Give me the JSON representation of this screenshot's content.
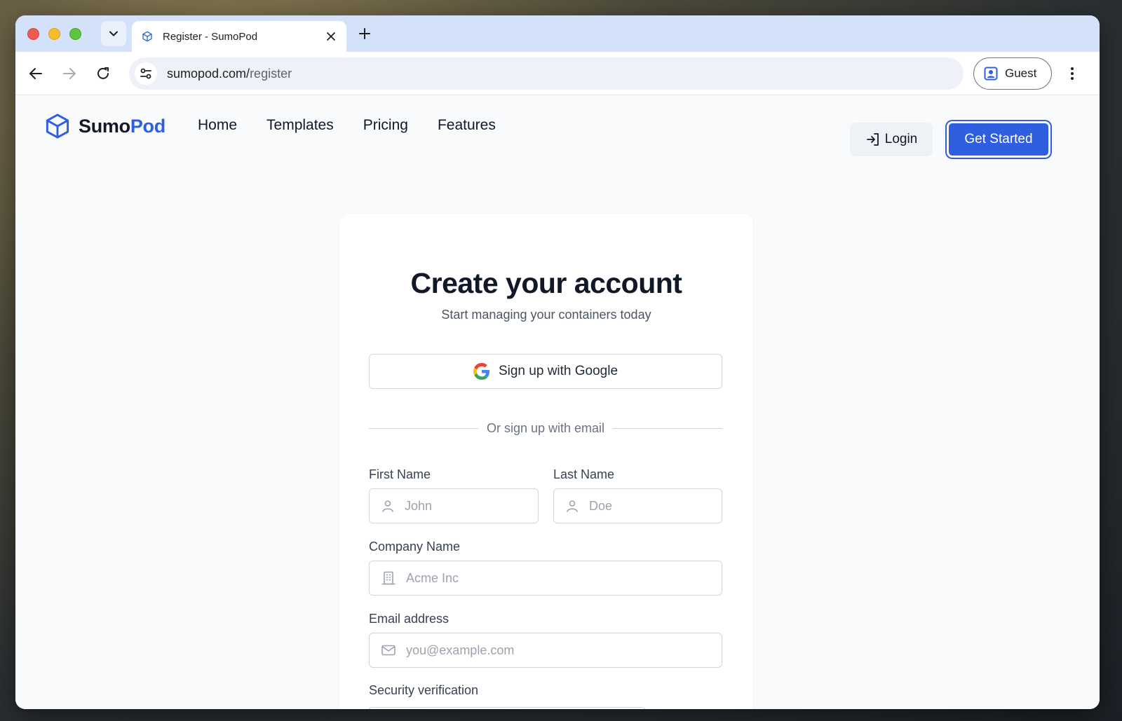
{
  "browser": {
    "tab_title": "Register - SumoPod",
    "url_host": "sumopod.com/",
    "url_path": "register",
    "profile_label": "Guest"
  },
  "site": {
    "brand_part1": "Sumo",
    "brand_part2": "Pod",
    "nav": [
      "Home",
      "Templates",
      "Pricing",
      "Features"
    ],
    "login_label": "Login",
    "cta_label": "Get Started",
    "accent_color": "#2f5ee0"
  },
  "form": {
    "title": "Create your account",
    "subtitle": "Start managing your containers today",
    "google_label": "Sign up with Google",
    "divider_label": "Or sign up with email",
    "first_name": {
      "label": "First Name",
      "placeholder": "John",
      "value": ""
    },
    "last_name": {
      "label": "Last Name",
      "placeholder": "Doe",
      "value": ""
    },
    "company": {
      "label": "Company Name",
      "placeholder": "Acme Inc",
      "value": ""
    },
    "email": {
      "label": "Email address",
      "placeholder": "you@example.com",
      "value": ""
    },
    "security_label": "Security verification"
  }
}
